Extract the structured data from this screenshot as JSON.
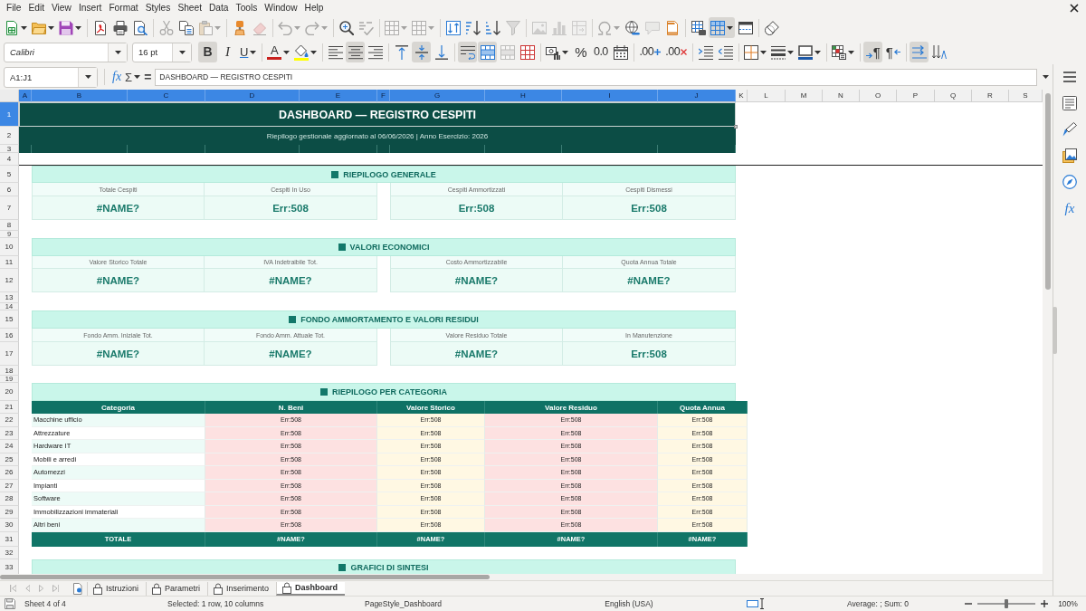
{
  "menu_bar": [
    "File",
    "Edit",
    "View",
    "Insert",
    "Format",
    "Styles",
    "Sheet",
    "Data",
    "Tools",
    "Window",
    "Help"
  ],
  "standard_toolbar": [
    [
      {
        "kind": "new",
        "dropdown": true,
        "disabled": false,
        "on": false
      },
      {
        "kind": "open",
        "dropdown": true,
        "disabled": false,
        "on": false
      },
      {
        "kind": "save",
        "dropdown": true,
        "disabled": false,
        "on": false
      }
    ],
    [
      {
        "kind": "pdf",
        "dropdown": false,
        "disabled": false,
        "on": false
      },
      {
        "kind": "print",
        "dropdown": false,
        "disabled": false,
        "on": false
      },
      {
        "kind": "preview",
        "dropdown": false,
        "disabled": false,
        "on": false
      }
    ],
    [
      {
        "kind": "cut",
        "dropdown": false,
        "disabled": true,
        "on": false
      },
      {
        "kind": "copy",
        "dropdown": false,
        "disabled": false,
        "on": false
      },
      {
        "kind": "paste",
        "dropdown": true,
        "disabled": true,
        "on": false
      }
    ],
    [
      {
        "kind": "clone",
        "dropdown": false,
        "disabled": false,
        "on": false
      },
      {
        "kind": "clear",
        "dropdown": false,
        "disabled": true,
        "on": false
      }
    ],
    [
      {
        "kind": "undo",
        "dropdown": true,
        "disabled": true,
        "on": false
      },
      {
        "kind": "redo",
        "dropdown": true,
        "disabled": true,
        "on": false
      }
    ],
    [
      {
        "kind": "find",
        "dropdown": false,
        "disabled": false,
        "on": false
      },
      {
        "kind": "spelling",
        "dropdown": false,
        "disabled": true,
        "on": false
      }
    ],
    [
      {
        "kind": "row",
        "dropdown": true,
        "disabled": true,
        "on": false
      },
      {
        "kind": "column",
        "dropdown": true,
        "disabled": true,
        "on": false
      }
    ],
    [
      {
        "kind": "sort",
        "dropdown": false,
        "disabled": false,
        "on": false
      },
      {
        "kind": "ascending",
        "dropdown": false,
        "disabled": false,
        "on": false
      },
      {
        "kind": "descending",
        "dropdown": false,
        "disabled": false,
        "on": false
      },
      {
        "kind": "filter",
        "dropdown": false,
        "disabled": true,
        "on": false
      }
    ],
    [
      {
        "kind": "image",
        "dropdown": false,
        "disabled": true,
        "on": false
      },
      {
        "kind": "chart",
        "dropdown": false,
        "disabled": true,
        "on": false
      },
      {
        "kind": "pivot",
        "dropdown": false,
        "disabled": true,
        "on": false
      }
    ],
    [
      {
        "kind": "symbol",
        "dropdown": true,
        "disabled": true,
        "on": false
      },
      {
        "kind": "hyperlink",
        "dropdown": false,
        "disabled": false,
        "on": false
      },
      {
        "kind": "comment",
        "dropdown": false,
        "disabled": true,
        "on": false
      },
      {
        "kind": "headers",
        "dropdown": false,
        "disabled": false,
        "on": false
      }
    ],
    [
      {
        "kind": "printarea",
        "dropdown": false,
        "disabled": false,
        "on": false
      },
      {
        "kind": "freeze",
        "dropdown": true,
        "disabled": false,
        "on": true
      },
      {
        "kind": "split",
        "dropdown": false,
        "disabled": false,
        "on": false
      }
    ],
    [
      {
        "kind": "draw",
        "dropdown": false,
        "disabled": false,
        "on": false
      }
    ]
  ],
  "formatting_toolbar": {
    "font_name": "Calibri",
    "font_size": "16 pt",
    "groups": [
      [
        {
          "kind": "bold",
          "label": "B",
          "dropdown": false,
          "disabled": false,
          "on": true
        },
        {
          "kind": "italic",
          "label": "I",
          "dropdown": false,
          "disabled": false,
          "on": false
        },
        {
          "kind": "underline",
          "label": "U",
          "dropdown": true,
          "disabled": false,
          "on": false
        }
      ],
      [
        {
          "kind": "fontcolor",
          "label": "A",
          "color": "#c9211e",
          "dropdown": true,
          "disabled": false,
          "on": false
        },
        {
          "kind": "highlight",
          "color": "#ffff00",
          "dropdown": true,
          "disabled": false,
          "on": false
        }
      ],
      [
        {
          "kind": "left",
          "dropdown": false,
          "disabled": false,
          "on": false
        },
        {
          "kind": "center",
          "dropdown": false,
          "disabled": false,
          "on": true
        },
        {
          "kind": "right",
          "dropdown": false,
          "disabled": false,
          "on": false
        }
      ],
      [
        {
          "kind": "top",
          "dropdown": false,
          "disabled": false,
          "on": false
        },
        {
          "kind": "middle",
          "dropdown": false,
          "disabled": false,
          "on": true
        },
        {
          "kind": "bottom",
          "dropdown": false,
          "disabled": false,
          "on": false
        }
      ],
      [
        {
          "kind": "wrap",
          "dropdown": false,
          "disabled": false,
          "on": true
        },
        {
          "kind": "mergecenter",
          "dropdown": false,
          "disabled": false,
          "on": true
        },
        {
          "kind": "merge",
          "dropdown": false,
          "disabled": true,
          "on": false
        },
        {
          "kind": "unmerge",
          "dropdown": false,
          "disabled": false,
          "on": false
        }
      ],
      [
        {
          "kind": "currency",
          "dropdown": true,
          "disabled": false,
          "on": false
        },
        {
          "kind": "percent",
          "label": "%",
          "dropdown": false,
          "disabled": false,
          "on": false
        },
        {
          "kind": "number",
          "label": "0.0",
          "dropdown": false,
          "disabled": false,
          "on": false
        },
        {
          "kind": "date",
          "dropdown": false,
          "disabled": false,
          "on": false
        }
      ],
      [
        {
          "kind": "adddecimal",
          "label": ".00",
          "dropdown": false,
          "disabled": false,
          "on": false
        },
        {
          "kind": "deletedecimal",
          "label": ".00",
          "dropdown": false,
          "disabled": false,
          "on": false
        }
      ],
      [
        {
          "kind": "indent",
          "dropdown": false,
          "disabled": false,
          "on": false
        },
        {
          "kind": "outdent",
          "dropdown": false,
          "disabled": false,
          "on": false
        }
      ],
      [
        {
          "kind": "borders",
          "dropdown": true,
          "disabled": false,
          "on": false
        },
        {
          "kind": "borderstyle",
          "dropdown": true,
          "disabled": false,
          "on": false
        },
        {
          "kind": "bordercolor",
          "color": "#1e5aa8",
          "dropdown": true,
          "disabled": false,
          "on": false
        }
      ],
      [
        {
          "kind": "conditional",
          "dropdown": true,
          "disabled": false,
          "on": false
        }
      ],
      [
        {
          "kind": "ltr",
          "label": "¶",
          "dropdown": false,
          "disabled": false,
          "on": true
        },
        {
          "kind": "rtl",
          "label": "¶",
          "dropdown": false,
          "disabled": false,
          "on": false
        }
      ],
      [
        {
          "kind": "direction",
          "dropdown": false,
          "disabled": false,
          "on": true
        },
        {
          "kind": "stacked",
          "dropdown": false,
          "disabled": false,
          "on": false
        }
      ]
    ]
  },
  "formula_bar": {
    "name_box": "A1:J1",
    "function_wizard": "fx",
    "sum": "Σ",
    "equals": "=",
    "formula": "DASHBOARD — REGISTRO CESPITI"
  },
  "sidebar": [
    {
      "kind": "properties",
      "selected": false
    },
    {
      "kind": "styles",
      "selected": false
    },
    {
      "kind": "gallery",
      "selected": false
    },
    {
      "kind": "navigator",
      "selected": false
    },
    {
      "kind": "functions",
      "label": "fx",
      "selected": false
    }
  ],
  "sheet": {
    "columns": [
      {
        "label": "A",
        "selected": true
      },
      {
        "label": "B",
        "selected": true
      },
      {
        "label": "C",
        "selected": true
      },
      {
        "label": "D",
        "selected": true
      },
      {
        "label": "E",
        "selected": true
      },
      {
        "label": "F",
        "selected": true
      },
      {
        "label": "G",
        "selected": true
      },
      {
        "label": "H",
        "selected": true
      },
      {
        "label": "I",
        "selected": true
      },
      {
        "label": "J",
        "selected": true
      },
      {
        "label": "K",
        "selected": false
      },
      {
        "label": "L",
        "selected": false
      },
      {
        "label": "M",
        "selected": false
      },
      {
        "label": "N",
        "selected": false
      },
      {
        "label": "O",
        "selected": false
      },
      {
        "label": "P",
        "selected": false
      },
      {
        "label": "Q",
        "selected": false
      },
      {
        "label": "R",
        "selected": false
      },
      {
        "label": "S",
        "selected": false
      }
    ],
    "rows": [
      {
        "label": "1",
        "selected": true
      },
      {
        "label": "2",
        "selected": false
      },
      {
        "label": "3",
        "selected": false
      },
      {
        "label": "4",
        "selected": false
      },
      {
        "label": "5",
        "selected": false
      },
      {
        "label": "6",
        "selected": false
      },
      {
        "label": "7",
        "selected": false
      },
      {
        "label": "8",
        "selected": false
      },
      {
        "label": "9",
        "selected": false
      },
      {
        "label": "10",
        "selected": false
      },
      {
        "label": "11",
        "selected": false
      },
      {
        "label": "12",
        "selected": false
      },
      {
        "label": "13",
        "selected": false
      },
      {
        "label": "14",
        "selected": false
      },
      {
        "label": "15",
        "selected": false
      },
      {
        "label": "16",
        "selected": false
      },
      {
        "label": "17",
        "selected": false
      },
      {
        "label": "18",
        "selected": false
      },
      {
        "label": "19",
        "selected": false
      },
      {
        "label": "20",
        "selected": false
      },
      {
        "label": "21",
        "selected": false
      },
      {
        "label": "22",
        "selected": false
      },
      {
        "label": "23",
        "selected": false
      },
      {
        "label": "24",
        "selected": false
      },
      {
        "label": "25",
        "selected": false
      },
      {
        "label": "26",
        "selected": false
      },
      {
        "label": "27",
        "selected": false
      },
      {
        "label": "28",
        "selected": false
      },
      {
        "label": "29",
        "selected": false
      },
      {
        "label": "30",
        "selected": false
      },
      {
        "label": "31",
        "selected": false
      },
      {
        "label": "32",
        "selected": false
      },
      {
        "label": "33",
        "selected": false
      }
    ],
    "title": {
      "text": "DASHBOARD — REGISTRO CESPITI",
      "selected": true
    },
    "subtitle": "Riepilogo gestionale aggiornato al 06/06/2026 | Anno Esercizio: 2026",
    "sections": [
      {
        "kind": "kpi",
        "title": "RIEPILOGO GENERALE",
        "groups": [
          [
            {
              "label": "Totale Cespiti",
              "value": "#NAME?"
            },
            {
              "label": "Cespiti In Uso",
              "value": "Err:508"
            }
          ],
          [
            {
              "label": "Cespiti Ammortizzati",
              "value": "Err:508"
            },
            {
              "label": "Cespiti Dismessi",
              "value": "Err:508"
            }
          ]
        ]
      },
      {
        "kind": "kpi",
        "title": "VALORI ECONOMICI",
        "groups": [
          [
            {
              "label": "Valore Storico Totale",
              "value": "#NAME?"
            },
            {
              "label": "IVA Indetraibile Tot.",
              "value": "#NAME?"
            }
          ],
          [
            {
              "label": "Costo Ammortizzabile",
              "value": "#NAME?"
            },
            {
              "label": "Quota Annua Totale",
              "value": "#NAME?"
            }
          ]
        ]
      },
      {
        "kind": "kpi",
        "title": "FONDO AMMORTAMENTO E VALORI RESIDUI",
        "groups": [
          [
            {
              "label": "Fondo Amm. Iniziale Tot.",
              "value": "#NAME?"
            },
            {
              "label": "Fondo Amm. Attuale Tot.",
              "value": "#NAME?"
            }
          ],
          [
            {
              "label": "Valore Residuo Totale",
              "value": "#NAME?"
            },
            {
              "label": "In Manutenzione",
              "value": "Err:508"
            }
          ]
        ]
      },
      {
        "kind": "table",
        "title": "RIEPILOGO PER CATEGORIA",
        "columns": [
          "Categoria",
          "N. Beni",
          "Valore Storico",
          "Valore Residuo",
          "Quota Annua"
        ],
        "rows": [
          [
            "Macchine ufficio",
            "Err:508",
            "Err:508",
            "Err:508",
            "Err:508"
          ],
          [
            "Attrezzature",
            "Err:508",
            "Err:508",
            "Err:508",
            "Err:508"
          ],
          [
            "Hardware IT",
            "Err:508",
            "Err:508",
            "Err:508",
            "Err:508"
          ],
          [
            "Mobili e arredi",
            "Err:508",
            "Err:508",
            "Err:508",
            "Err:508"
          ],
          [
            "Automezzi",
            "Err:508",
            "Err:508",
            "Err:508",
            "Err:508"
          ],
          [
            "Impianti",
            "Err:508",
            "Err:508",
            "Err:508",
            "Err:508"
          ],
          [
            "Software",
            "Err:508",
            "Err:508",
            "Err:508",
            "Err:508"
          ],
          [
            "Immobilizzazioni immateriali",
            "Err:508",
            "Err:508",
            "Err:508",
            "Err:508"
          ],
          [
            "Altri beni",
            "Err:508",
            "Err:508",
            "Err:508",
            "Err:508"
          ]
        ],
        "total": [
          "TOTALE",
          "#NAME?",
          "#NAME?",
          "#NAME?",
          "#NAME?"
        ]
      },
      {
        "kind": "heading",
        "title": "GRAFICI DI SINTESI"
      }
    ]
  },
  "sheet_tabs": {
    "navigation": [
      {
        "kind": "first",
        "disabled": true
      },
      {
        "kind": "previous",
        "disabled": true
      },
      {
        "kind": "next",
        "disabled": true
      },
      {
        "kind": "last",
        "disabled": true
      }
    ],
    "tabs": [
      {
        "label": "Istruzioni",
        "locked": true,
        "selected": false
      },
      {
        "label": "Parametri",
        "locked": true,
        "selected": false
      },
      {
        "label": "Inserimento",
        "locked": true,
        "selected": false
      },
      {
        "label": "Dashboard",
        "locked": true,
        "selected": true
      }
    ]
  },
  "status_bar": {
    "sheet": "Sheet 4 of 4",
    "selection": "Selected: 1 row, 10 columns",
    "page_style": "PageStyle_Dashboard",
    "language": "English (USA)",
    "summary": "Average: ; Sum: 0",
    "zoom": {
      "level": 0.5,
      "label": "100%"
    }
  }
}
